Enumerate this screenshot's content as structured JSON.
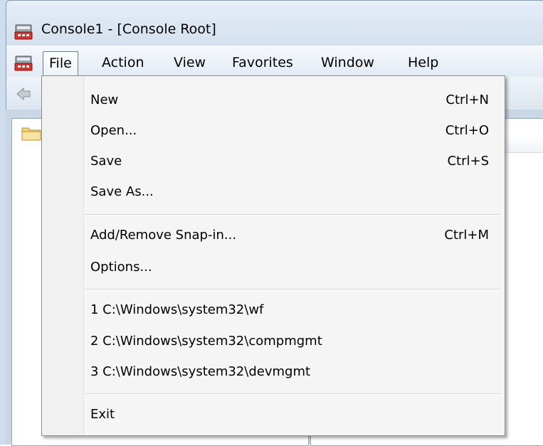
{
  "window": {
    "title": "Console1 - [Console Root]",
    "icon": "mmc-console-icon"
  },
  "menubar": {
    "items": [
      {
        "label": "File",
        "active": true
      },
      {
        "label": "Action"
      },
      {
        "label": "View"
      },
      {
        "label": "Favorites"
      },
      {
        "label": "Window"
      },
      {
        "label": "Help"
      }
    ]
  },
  "toolbar": {
    "back_icon": "back-arrow-icon"
  },
  "tree": {
    "root_icon": "folder-icon"
  },
  "file_menu": {
    "groups": [
      [
        {
          "label": "New",
          "shortcut": "Ctrl+N"
        },
        {
          "label": "Open...",
          "shortcut": "Ctrl+O"
        },
        {
          "label": "Save",
          "shortcut": "Ctrl+S"
        },
        {
          "label": "Save As...",
          "shortcut": ""
        }
      ],
      [
        {
          "label": "Add/Remove Snap-in...",
          "shortcut": "Ctrl+M"
        },
        {
          "label": "Options...",
          "shortcut": ""
        }
      ],
      [
        {
          "label": "1 C:\\Windows\\system32\\wf",
          "shortcut": ""
        },
        {
          "label": "2 C:\\Windows\\system32\\compmgmt",
          "shortcut": ""
        },
        {
          "label": "3 C:\\Windows\\system32\\devmgmt",
          "shortcut": ""
        }
      ],
      [
        {
          "label": "Exit",
          "shortcut": ""
        }
      ]
    ]
  },
  "colors": {
    "titlebar": "#d3e0ee",
    "menu_background": "#f5f5f5",
    "active_menu_border": "#6f7b88"
  }
}
